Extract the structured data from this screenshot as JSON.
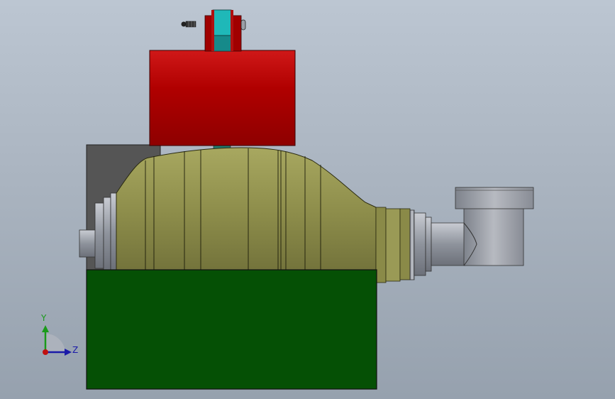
{
  "viewport": {
    "background_top": "#bcc6d2",
    "background_bottom": "#96a1ae"
  },
  "model": {
    "base_block_color": "#055005",
    "motor_color": "#a50000",
    "pump_casing_color": "#8a8a48",
    "back_plate_color": "#555555",
    "coupling_color": "#1fb8b8",
    "metal_color": "#9a9ea8"
  },
  "triad": {
    "y_label": "Y",
    "z_label": "Z",
    "y_color": "#1a9a1a",
    "z_color": "#1a1aa8",
    "x_color": "#c01010"
  }
}
